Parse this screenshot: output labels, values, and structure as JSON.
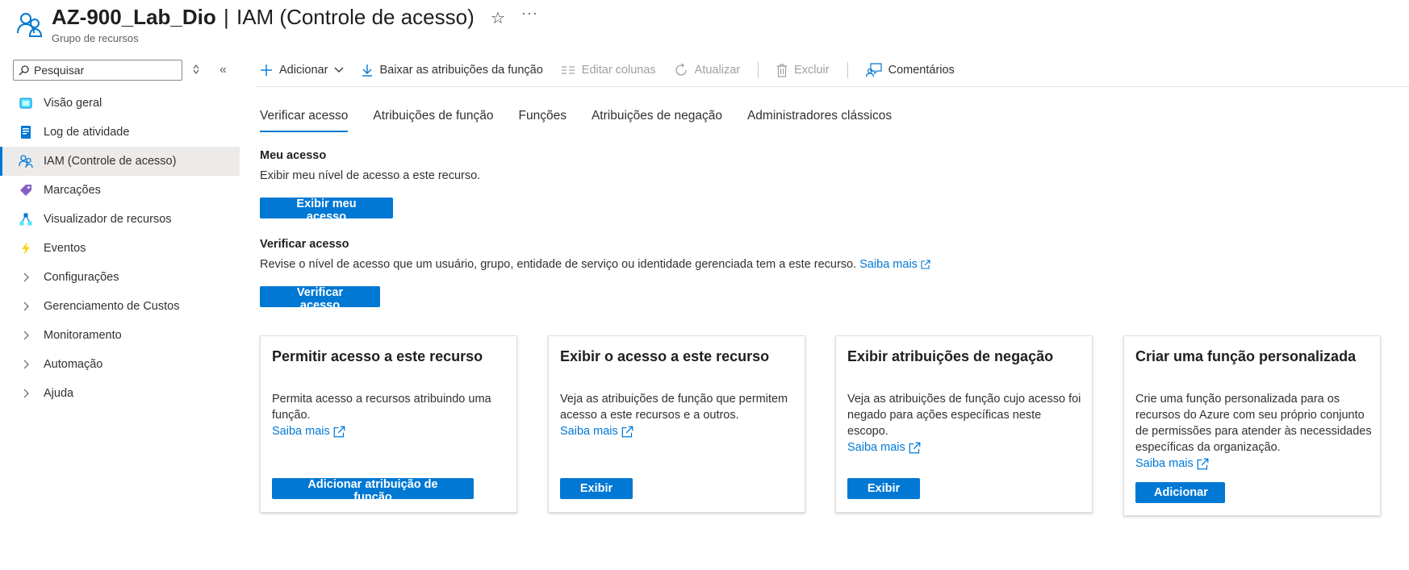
{
  "header": {
    "resource_name": "AZ-900_Lab_Dio",
    "separator": "|",
    "blade_name": "IAM (Controle de acesso)",
    "subtitle": "Grupo de recursos",
    "favorite_icon": "star-icon",
    "more_label": "···"
  },
  "sidebar": {
    "search_placeholder": "Pesquisar",
    "collapse_glyph": "«",
    "items": [
      {
        "label": "Visão geral",
        "icon": "overview-icon"
      },
      {
        "label": "Log de atividade",
        "icon": "activity-log-icon"
      },
      {
        "label": "IAM (Controle de acesso)",
        "icon": "users-icon",
        "active": true
      },
      {
        "label": "Marcações",
        "icon": "tag-icon"
      },
      {
        "label": "Visualizador de recursos",
        "icon": "resource-visualizer-icon"
      },
      {
        "label": "Eventos",
        "icon": "lightning-icon"
      },
      {
        "label": "Configurações",
        "icon": "chevron-right-icon"
      },
      {
        "label": "Gerenciamento de Custos",
        "icon": "chevron-right-icon"
      },
      {
        "label": "Monitoramento",
        "icon": "chevron-right-icon"
      },
      {
        "label": "Automação",
        "icon": "chevron-right-icon"
      },
      {
        "label": "Ajuda",
        "icon": "chevron-right-icon"
      }
    ]
  },
  "toolbar": {
    "add": "Adicionar",
    "download": "Baixar as atribuições da função",
    "edit_columns": "Editar colunas",
    "refresh": "Atualizar",
    "delete": "Excluir",
    "feedback": "Comentários"
  },
  "tabs": [
    {
      "label": "Verificar acesso",
      "active": true
    },
    {
      "label": "Atribuições de função"
    },
    {
      "label": "Funções"
    },
    {
      "label": "Atribuições de negação"
    },
    {
      "label": "Administradores clássicos"
    }
  ],
  "my_access": {
    "heading": "Meu acesso",
    "description": "Exibir meu nível de acesso a este recurso.",
    "button": "Exibir meu acesso"
  },
  "check_access": {
    "heading": "Verificar acesso",
    "description": "Revise o nível de acesso que um usuário, grupo, entidade de serviço ou identidade gerenciada tem a este recurso.",
    "link": "Saiba mais",
    "button": "Verificar acesso"
  },
  "cards": [
    {
      "title": "Permitir acesso a este recurso",
      "description": "Permita acesso a recursos atribuindo uma função.",
      "link": "Saiba mais",
      "button": "Adicionar atribuição de função"
    },
    {
      "title": "Exibir o acesso a este recurso",
      "description": "Veja as atribuições de função que permitem acesso a este recursos e a outros.",
      "link": "Saiba mais",
      "button": "Exibir"
    },
    {
      "title": "Exibir atribuições de negação",
      "description": "Veja as atribuições de função cujo acesso foi negado para ações específicas neste escopo.",
      "link": "Saiba mais",
      "button": "Exibir"
    },
    {
      "title": "Criar uma função personalizada",
      "description": "Crie uma função personalizada para os recursos do Azure com seu próprio conjunto de permissões para atender às necessidades específicas da organização.",
      "link": "Saiba mais",
      "button": "Adicionar"
    }
  ],
  "colors": {
    "accent": "#0078d4",
    "text": "#323130",
    "disabled": "#a19f9d",
    "nav_active_bg": "#edebe9"
  }
}
